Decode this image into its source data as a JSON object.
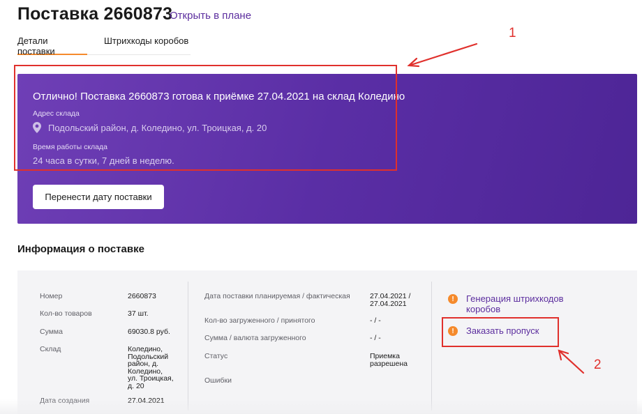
{
  "header": {
    "title": "Поставка 2660873",
    "open_in_plan": "Открыть в плане"
  },
  "tabs": [
    {
      "label": "Детали поставки",
      "active": true
    },
    {
      "label": "Штрихкоды коробов",
      "active": false
    }
  ],
  "banner": {
    "message": "Отлично! Поставка 2660873 готова к приёмке 27.04.2021 на склад Коледино",
    "address_label": "Адрес склада",
    "address": "Подольский район, д. Коледино, ул. Троицкая, д. 20",
    "hours_label": "Время работы склада",
    "hours": "24 часа в сутки, 7 дней в неделю.",
    "button": "Перенести дату поставки",
    "colors": {
      "gradient_start": "#6f3fb6",
      "gradient_end": "#4d2596"
    }
  },
  "info": {
    "title": "Информация о поставке",
    "left": [
      {
        "key": "Номер",
        "value": "2660873"
      },
      {
        "key": "Кол-во товаров",
        "value": "37 шт."
      },
      {
        "key": "Сумма",
        "value": "69030.8 руб."
      },
      {
        "key": "Склад",
        "value": "Коледино,\nПодольский\nрайон, д.\nКоледино,\nул. Троицкая,\nд. 20"
      },
      {
        "key": "Дата создания",
        "value": "27.04.2021"
      }
    ],
    "middle": [
      {
        "key": "Дата поставки планируемая / фактическая",
        "value": "27.04.2021 /\n27.04.2021"
      },
      {
        "key": "Кол-во загруженного / принятого",
        "value": "- / -"
      },
      {
        "key": "Сумма / валюта загруженного",
        "value": "- / -"
      },
      {
        "key": "Статус",
        "value": "Приемка\nразрешена"
      },
      {
        "key": "Ошибки",
        "value": ""
      }
    ],
    "actions": [
      {
        "label": "Генерация штрихкодов\nкоробов",
        "icon": "warning-icon"
      },
      {
        "label": "Заказать пропуск",
        "icon": "warning-icon"
      }
    ]
  },
  "annotations": {
    "one": "1",
    "two": "2",
    "color": "#e0302c"
  },
  "accent_color": "#f58a2c",
  "link_color": "#5b2d9e"
}
